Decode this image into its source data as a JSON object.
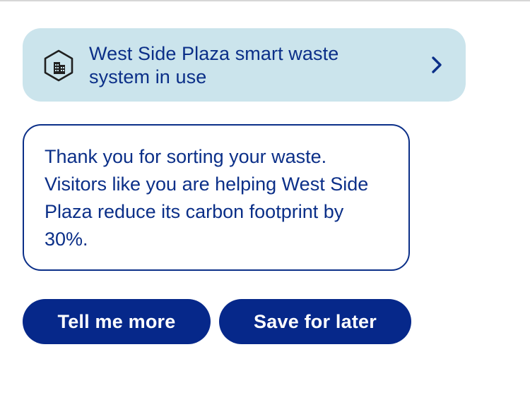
{
  "notification": {
    "title": "West Side Plaza smart waste system in use",
    "icon": "building-hexagon-icon",
    "action_icon": "chevron-right-icon"
  },
  "message": {
    "text": "Thank you for sorting your waste. Visitors like you are helping West Side Plaza reduce its carbon footprint by 30%."
  },
  "actions": {
    "tell_more_label": "Tell me more",
    "save_later_label": "Save for later"
  },
  "colors": {
    "primary": "#0b2f88",
    "button": "#06288a",
    "card_background": "#cbe4ec",
    "background": "#ffffff"
  }
}
